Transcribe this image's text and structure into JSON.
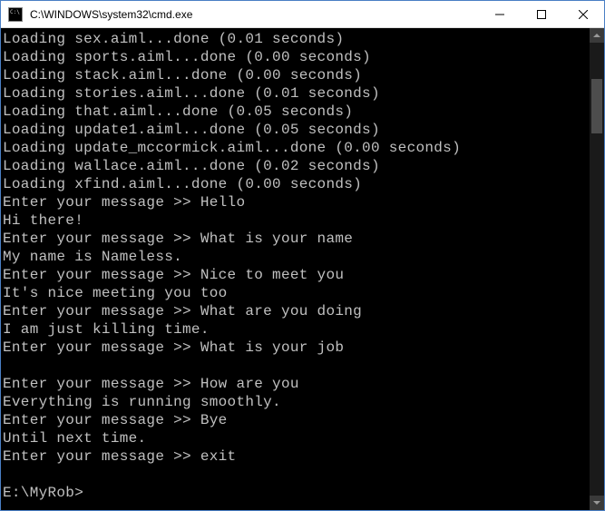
{
  "titlebar": {
    "title": "C:\\WINDOWS\\system32\\cmd.exe"
  },
  "terminal": {
    "lines": [
      "Loading sex.aiml...done (0.01 seconds)",
      "Loading sports.aiml...done (0.00 seconds)",
      "Loading stack.aiml...done (0.00 seconds)",
      "Loading stories.aiml...done (0.01 seconds)",
      "Loading that.aiml...done (0.05 seconds)",
      "Loading update1.aiml...done (0.05 seconds)",
      "Loading update_mccormick.aiml...done (0.00 seconds)",
      "Loading wallace.aiml...done (0.02 seconds)",
      "Loading xfind.aiml...done (0.00 seconds)",
      "Enter your message >> Hello",
      "Hi there!",
      "Enter your message >> What is your name",
      "My name is Nameless.",
      "Enter your message >> Nice to meet you",
      "It's nice meeting you too",
      "Enter your message >> What are you doing",
      "I am just killing time.",
      "Enter your message >> What is your job",
      "",
      "Enter your message >> How are you",
      "Everything is running smoothly.",
      "Enter your message >> Bye",
      "Until next time.",
      "Enter your message >> exit",
      "",
      "E:\\MyRob>"
    ]
  }
}
